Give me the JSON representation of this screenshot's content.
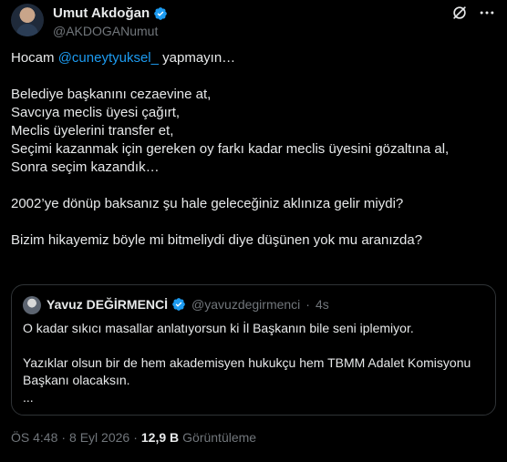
{
  "author": {
    "display_name": "Umut Akdoğan",
    "handle": "@AKDOGANumut"
  },
  "icons": {
    "verified": "verified-badge-icon",
    "grok": "grok-icon",
    "more": "more-options-icon"
  },
  "colors": {
    "background": "#000000",
    "text": "#e7e9ea",
    "secondary": "#71767b",
    "accent": "#1d9bf0",
    "border": "#2f3336"
  },
  "tweet": {
    "line1_prefix": "Hocam ",
    "line1_mention": "@cuneytyuksel_",
    "line1_suffix": " yapmayın…",
    "line2": "Belediye başkanını cezaevine at,",
    "line3": "Savcıya meclis üyesi çağırt,",
    "line4": "Meclis üyelerini transfer et,",
    "line5": "Seçimi kazanmak için gereken oy farkı kadar meclis üyesini gözaltına al,",
    "line6": "Sonra seçim kazandık…",
    "line7": "2002’ye dönüp baksanız şu hale geleceğiniz aklınıza gelir miydi?",
    "line8": "Bizim hikayemiz böyle mi bitmeliydi diye düşünen yok mu aranızda?"
  },
  "quote": {
    "display_name": "Yavuz DEĞİRMENCİ",
    "handle": "@yavuzdegirmenci",
    "separator": "·",
    "time": "4s",
    "line1": "O kadar sıkıcı masallar anlatıyorsun ki İl Başkanın bile seni iplemiyor.",
    "line2": "Yazıklar olsun bir de hem akademisyen hukukçu hem TBMM Adalet Komisyonu Başkanı olacaksın.",
    "line3": "..."
  },
  "footer": {
    "time": "ÖS 4:48",
    "separator": "·",
    "date": "8 Eyl 2026",
    "separator2": "·",
    "views_count": "12,9 B",
    "views_label": "Görüntüleme"
  }
}
